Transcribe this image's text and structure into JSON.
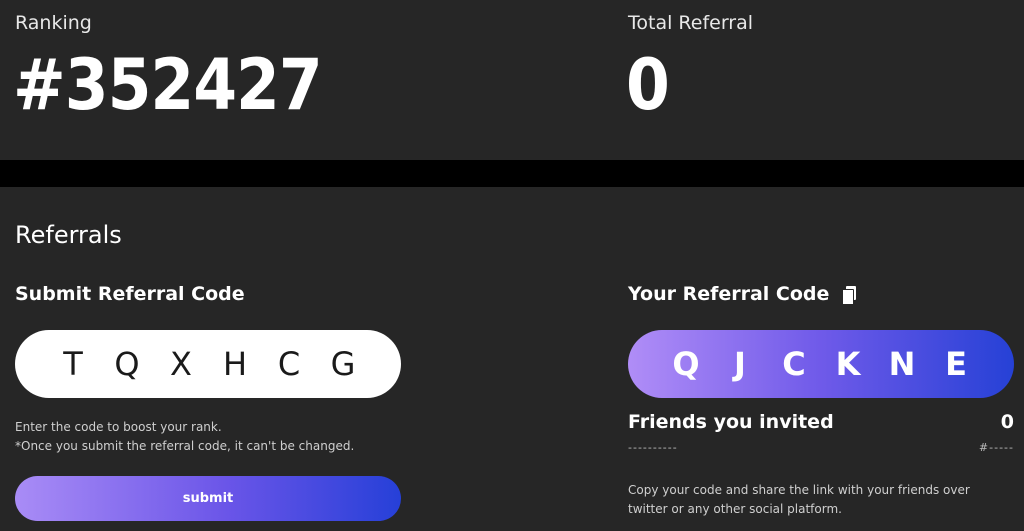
{
  "stats": {
    "ranking_label": "Ranking",
    "ranking_value": "#352427",
    "total_referral_label": "Total Referral",
    "total_referral_value": "0"
  },
  "referrals": {
    "title": "Referrals",
    "submit_section": {
      "title": "Submit Referral Code",
      "code_letters": [
        "T",
        "Q",
        "X",
        "H",
        "C",
        "G"
      ],
      "help_line1": "Enter the code to boost your rank.",
      "help_line2": "*Once you submit the referral code, it can't be changed.",
      "submit_label": "submit"
    },
    "your_code_section": {
      "title": "Your Referral Code",
      "copy_icon": "copy-icon",
      "code_letters": [
        "Q",
        "J",
        "C",
        "K",
        "N",
        "E"
      ],
      "friends_label": "Friends you invited",
      "friends_count": "0",
      "dash_left": "----------",
      "dash_right": "#-----",
      "share_text": "Copy your code and share the link with your friends over twitter or any other social platform."
    }
  },
  "colors": {
    "panel_bg": "#262626",
    "page_bg": "#000000",
    "gradient_start": "#a98cf6",
    "gradient_end": "#2640d8"
  }
}
